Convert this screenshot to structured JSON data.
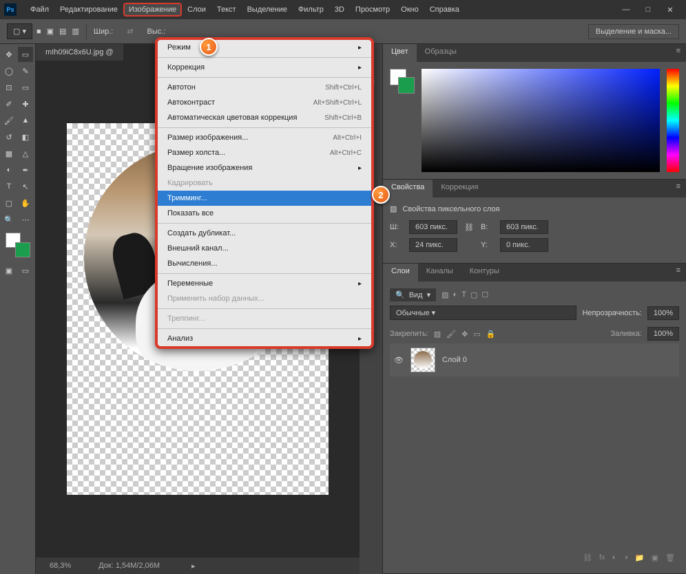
{
  "menubar": [
    "Файл",
    "Редактирование",
    "Изображение",
    "Слои",
    "Текст",
    "Выделение",
    "Фильтр",
    "3D",
    "Просмотр",
    "Окно",
    "Справка"
  ],
  "active_menu_index": 2,
  "toolbar": {
    "width_label": "Шир.:",
    "height_label": "Выс.:",
    "mask_button": "Выделение и маска..."
  },
  "document": {
    "tab_title": "mIh09iC8x6U.jpg @",
    "zoom": "68,3%",
    "doc_size": "Док: 1,54M/2,06M"
  },
  "dropdown": {
    "items": [
      {
        "label": "Режим",
        "type": "sub"
      },
      {
        "type": "sep"
      },
      {
        "label": "Коррекция",
        "type": "sub"
      },
      {
        "type": "sep"
      },
      {
        "label": "Автотон",
        "shortcut": "Shift+Ctrl+L"
      },
      {
        "label": "Автоконтраст",
        "shortcut": "Alt+Shift+Ctrl+L"
      },
      {
        "label": "Автоматическая цветовая коррекция",
        "shortcut": "Shift+Ctrl+B"
      },
      {
        "type": "sep"
      },
      {
        "label": "Размер изображения...",
        "shortcut": "Alt+Ctrl+I"
      },
      {
        "label": "Размер холста...",
        "shortcut": "Alt+Ctrl+C"
      },
      {
        "label": "Вращение изображения",
        "type": "sub"
      },
      {
        "label": "Кадрировать",
        "disabled": true
      },
      {
        "label": "Тримминг...",
        "selected": true
      },
      {
        "label": "Показать все"
      },
      {
        "type": "sep"
      },
      {
        "label": "Создать дубликат..."
      },
      {
        "label": "Внешний канал..."
      },
      {
        "label": "Вычисления..."
      },
      {
        "type": "sep"
      },
      {
        "label": "Переменные",
        "type": "sub"
      },
      {
        "label": "Применить набор данных...",
        "disabled": true
      },
      {
        "type": "sep"
      },
      {
        "label": "Треппинг...",
        "disabled": true
      },
      {
        "type": "sep"
      },
      {
        "label": "Анализ",
        "type": "sub"
      }
    ]
  },
  "markers": {
    "one": "1",
    "two": "2"
  },
  "panels": {
    "color": {
      "tabs": [
        "Цвет",
        "Образцы"
      ],
      "active": 0
    },
    "properties": {
      "tabs": [
        "Свойства",
        "Коррекция"
      ],
      "active": 0,
      "title": "Свойства пиксельного слоя",
      "w_label": "Ш:",
      "w_value": "603 пикс.",
      "h_label": "В:",
      "h_value": "603 пикс.",
      "x_label": "X:",
      "x_value": "24 пикс.",
      "y_label": "Y:",
      "y_value": "0 пикс."
    },
    "layers": {
      "tabs": [
        "Слои",
        "Каналы",
        "Контуры"
      ],
      "active": 0,
      "search_label": "Вид",
      "blend_mode": "Обычные",
      "opacity_label": "Непрозрачность:",
      "opacity_value": "100%",
      "lock_label": "Закрепить:",
      "fill_label": "Заливка:",
      "fill_value": "100%",
      "layer_name": "Слой 0"
    }
  }
}
